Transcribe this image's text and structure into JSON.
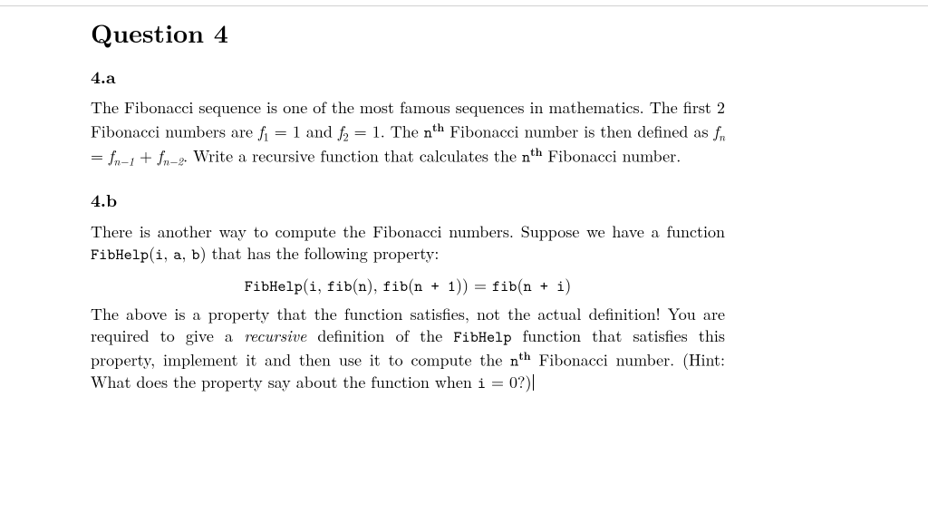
{
  "title": "Question 4",
  "parts": {
    "a": {
      "label": "4.a",
      "p1_a": "The Fibonacci sequence is one of the most famous sequences in mathematics. The first 2 Fibonacci numbers are ",
      "f1": "f",
      "f1_sub": "1",
      "eq1": " = 1",
      "and": " and ",
      "f2": "f",
      "f2_sub": "2",
      "eq2": " = 1",
      "p1_b": ". The ",
      "nth_n": "n",
      "nth_th": "th",
      "p1_c": " Fibonacci number is then defined as ",
      "fn": "f",
      "fn_sub": "n",
      "eq3": " = ",
      "fnm1": "f",
      "fnm1_sub": "n−1",
      "plus": " + ",
      "fnm2": "f",
      "fnm2_sub": "n−2",
      "p1_d": ". Write a recursive function that calculates the ",
      "p1_e": " Fibonacci number."
    },
    "b": {
      "label": "4.b",
      "p1_a": "There is another way to compute the Fibonacci numbers. Suppose we have a function ",
      "fh": "FibHelp",
      "args_open": "(",
      "arg_i": "i",
      "comma1": ", ",
      "arg_a": "a",
      "comma2": ", ",
      "arg_b": "b",
      "args_close": ")",
      "p1_b": " that has the following property:",
      "eq_lhs1": "FibHelp",
      "eq_open": "(",
      "eq_i": "i",
      "eq_c1": ", ",
      "eq_fib1": "fib",
      "eq_p1o": "(",
      "eq_n": "n",
      "eq_p1c": ")",
      "eq_c2": ", ",
      "eq_fib2": "fib",
      "eq_p2o": "(",
      "eq_np1": "n + 1",
      "eq_p2c": ")",
      "eq_close": ")",
      "eq_eq": " = ",
      "eq_fib3": "fib",
      "eq_p3o": "(",
      "eq_npi": "n + i",
      "eq_p3c": ")",
      "p2_a": "The above is a property that the function satisfies, not the actual definition! You are required to give a ",
      "recursive": "recursive",
      "p2_b": " definition of the ",
      "p2_c": " function that satisfies this property, implement it and then use it to compute the ",
      "p2_d": " Fibonacci number. (Hint: What does the property say about the function when ",
      "i_tt": "i",
      "eq0": " = 0",
      "p2_e": "?)"
    }
  }
}
